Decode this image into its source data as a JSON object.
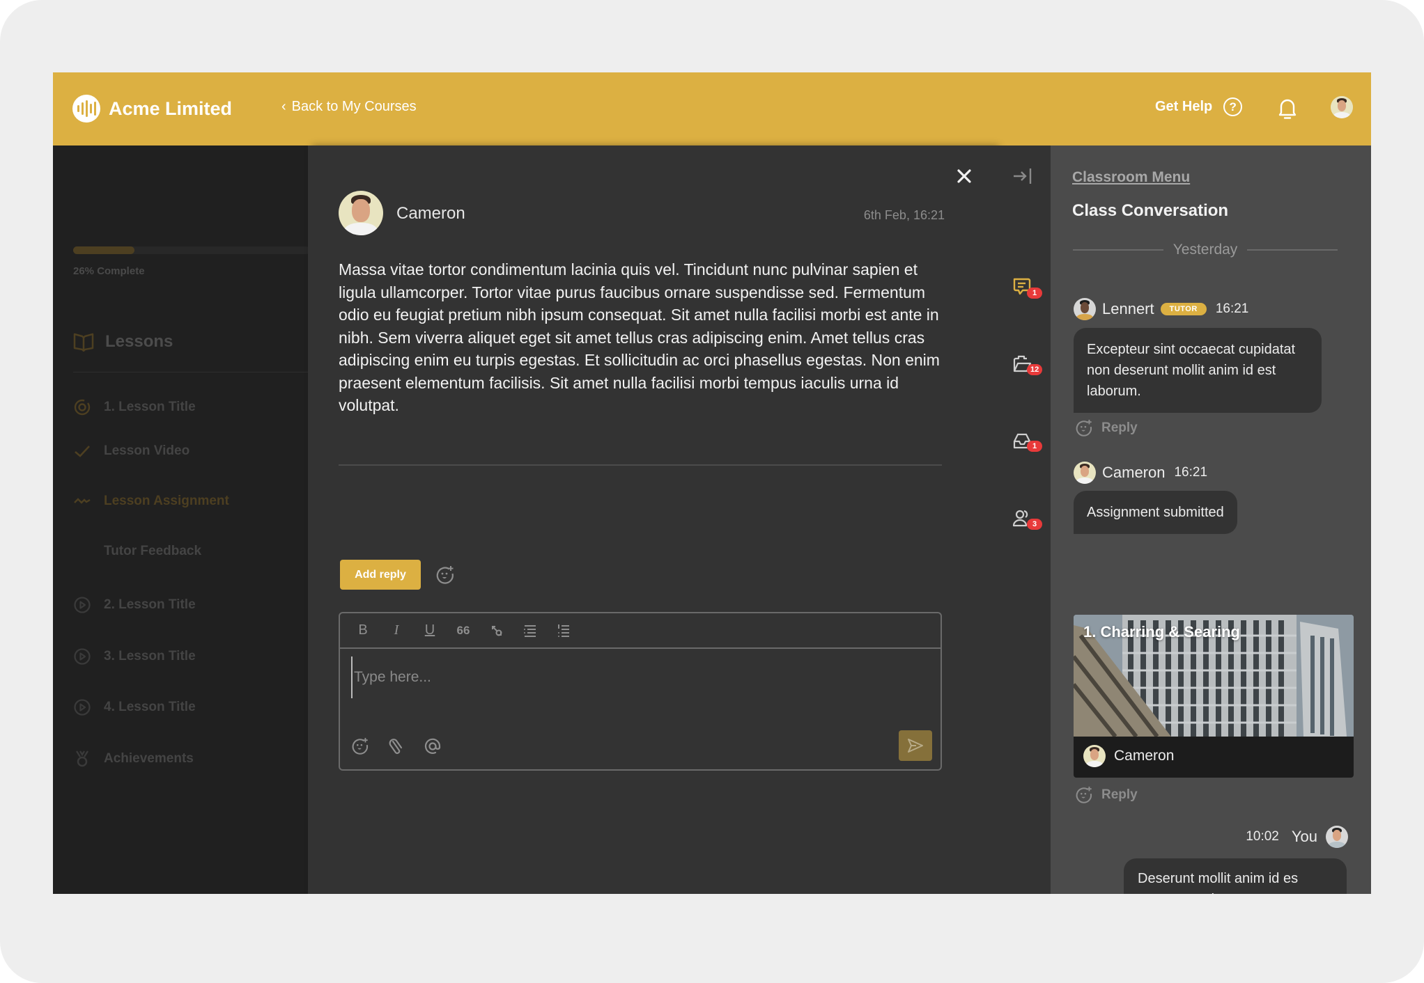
{
  "header": {
    "brand": "Acme Limited",
    "back_link": "Back to My Courses",
    "help_label": "Get Help",
    "accent_color": "#dcb042"
  },
  "sidebar": {
    "progress_percent": 26,
    "progress_label": "26% Complete",
    "section_title": "Lessons",
    "items": [
      {
        "label": "1. Lesson Title",
        "icon": "target-icon",
        "state": "in-progress"
      },
      {
        "label": "Lesson Video",
        "icon": "check-icon",
        "state": "done"
      },
      {
        "label": "Lesson Assignment",
        "icon": "wave-icon",
        "state": "active"
      },
      {
        "label": "Tutor Feedback",
        "icon": "",
        "state": "pending"
      },
      {
        "label": "2. Lesson Title",
        "icon": "play-circle-icon",
        "state": "locked"
      },
      {
        "label": "3. Lesson Title",
        "icon": "play-circle-icon",
        "state": "locked"
      },
      {
        "label": "4.  Lesson Title",
        "icon": "play-circle-icon",
        "state": "locked"
      },
      {
        "label": "Achievements",
        "icon": "medal-icon",
        "state": "locked"
      }
    ]
  },
  "post": {
    "author": "Cameron",
    "timestamp": "6th Feb, 16:21",
    "body": "Massa vitae tortor condimentum lacinia quis vel. Tincidunt nunc pulvinar sapien et ligula ullamcorper. Tortor vitae purus faucibus ornare suspendisse sed. Fermentum odio eu feugiat pretium nibh ipsum consequat. Sit amet nulla facilisi morbi est ante in nibh. Sem viverra aliquet eget sit amet tellus cras adipiscing enim. Amet tellus cras adipiscing enim eu turpis egestas. Et sollicitudin ac orci phasellus egestas. Non enim praesent elementum facilisis. Sit amet nulla facilisi morbi tempus iaculis urna id volutpat.",
    "add_reply_label": "Add reply"
  },
  "editor": {
    "toolbar": [
      "bold",
      "italic",
      "underline",
      "quote",
      "link",
      "bulleted-list",
      "numbered-list"
    ],
    "toolbar_glyphs": {
      "bold": "B",
      "italic": "I",
      "underline": "U",
      "quote": "66"
    },
    "placeholder": "Type here...",
    "value": ""
  },
  "rail": {
    "items": [
      {
        "name": "conversation",
        "badge": "1",
        "active": true
      },
      {
        "name": "assignments",
        "badge": "12",
        "active": false
      },
      {
        "name": "inbox",
        "badge": "1",
        "active": false
      },
      {
        "name": "members",
        "badge": "3",
        "active": false
      }
    ]
  },
  "chat": {
    "menu_link": "Classroom Menu",
    "title": "Class Conversation",
    "day_divider": "Yesterday",
    "reply_label": "Reply",
    "messages": [
      {
        "author": "Lennert",
        "role_badge": "TUTOR",
        "time": "16:21",
        "text": "Excepteur sint occaecat cupidatat non deserunt mollit anim id est laborum."
      },
      {
        "author": "Cameron",
        "time": "16:21",
        "text": "Assignment submitted",
        "attachment": {
          "title": "1. Charring & Searing",
          "author": "Cameron"
        }
      },
      {
        "author": "You",
        "time": "10:02",
        "text": "Deserunt mollit anim id es Excepteur sint occaecat cupidatat non deserunt mollit anim id est laborum."
      }
    ]
  }
}
